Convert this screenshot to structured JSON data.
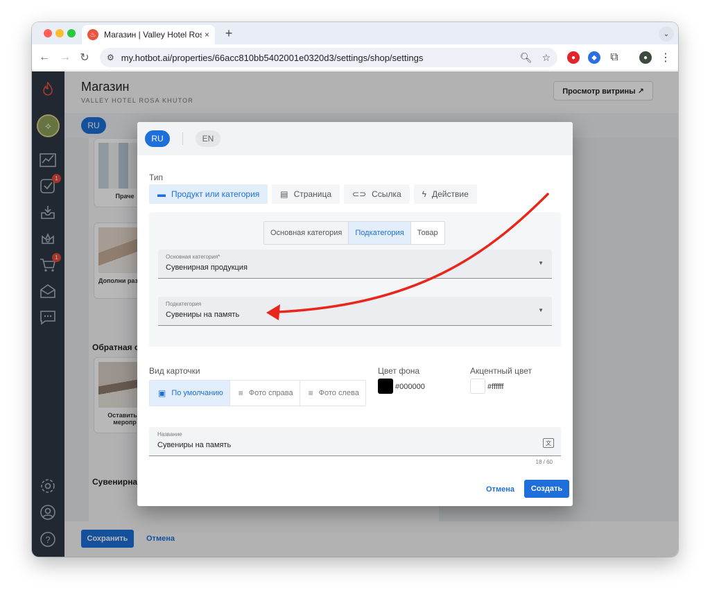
{
  "browser": {
    "tab_title": "Магазин | Valley Hotel Rosa K",
    "tab_close": "×",
    "new_tab": "+",
    "url": "my.hotbot.ai/properties/66acc810bb5402001e0320d3/settings/shop/settings"
  },
  "app": {
    "header": {
      "title": "Магазин",
      "subtitle": "VALLEY HOTEL ROSA KHUTOR",
      "storefront_button": "Просмотр витрины ↗"
    },
    "sidebar": {
      "badges": [
        "1",
        "1"
      ]
    },
    "lang_tabs": [
      "RU"
    ],
    "background": {
      "card_labels": [
        "Праче",
        "Дополни размещ",
        "Оставить з меропр"
      ],
      "sections": [
        "Обратная с",
        "Сувенирна"
      ]
    },
    "footer": {
      "save": "Сохранить",
      "cancel": "Отмена"
    }
  },
  "dialog": {
    "lang_tabs": [
      "RU",
      "EN"
    ],
    "type_label": "Тип",
    "type_options": [
      "Продукт или категория",
      "Страница",
      "Ссылка",
      "Действие"
    ],
    "type_selected": "Продукт или категория",
    "subtype_options": [
      "Основная категория",
      "Подкатегория",
      "Товар"
    ],
    "subtype_selected": "Подкатегория",
    "main_category": {
      "label": "Основная категория*",
      "value": "Сувенирная продукция"
    },
    "subcategory": {
      "label": "Подкатегория",
      "value": "Сувениры на память"
    },
    "card_view": {
      "label": "Вид карточки",
      "options": [
        "По умолчанию",
        "Фото справа",
        "Фото слева"
      ],
      "selected": "По умолчанию"
    },
    "bg_color": {
      "label": "Цвет фона",
      "value": "#000000"
    },
    "accent_color": {
      "label": "Акцентный цвет",
      "value": "#ffffff"
    },
    "name_field": {
      "label": "Название",
      "value": "Сувениры на память",
      "counter": "18 / 60"
    },
    "cancel": "Отмена",
    "create": "Создать"
  },
  "colors": {
    "primary": "#1e6fd9",
    "sidebar": "#2f3844",
    "annotation_arrow": "#e8261b"
  },
  "icons": {
    "browser": [
      "back-arrow-icon",
      "forward-arrow-icon",
      "reload-icon",
      "site-info-icon",
      "zoom-icon",
      "bookmark-star-icon",
      "extension-icon",
      "profile-icon",
      "kebab-menu-icon"
    ],
    "sidebar": [
      "flame-logo-icon",
      "analytics-icon",
      "tasks-icon",
      "inbox-icon",
      "crown-icon",
      "cart-icon",
      "mail-icon",
      "chat-icon",
      "settings-icon",
      "account-icon",
      "help-icon"
    ]
  }
}
